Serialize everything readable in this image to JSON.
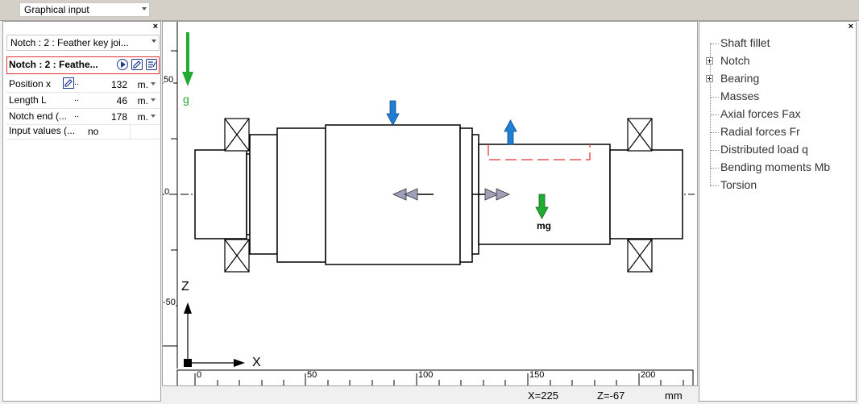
{
  "toolbar": {
    "view_select": "Graphical input"
  },
  "left_panel": {
    "close": "×",
    "element_select": "Notch : 2 : Feather key joi...",
    "header_title": "Notch : 2 : Feathe...",
    "rows": [
      {
        "label": "Position x",
        "value": "132",
        "unit": "m."
      },
      {
        "label": "Length L",
        "dots": "..",
        "value": "46",
        "unit": "m."
      },
      {
        "label": "Notch end (...",
        "dots": "..",
        "value": "178",
        "unit": "m."
      },
      {
        "label": "Input values (...",
        "value": "no"
      }
    ],
    "position_dots": ".."
  },
  "canvas": {
    "gravity_label": "g",
    "mass_label": "mg",
    "z_axis": "Z",
    "x_axis": "X",
    "vertical_ticks": [
      "50",
      "0",
      "-50"
    ],
    "horizontal_ticks": [
      "0",
      "50",
      "100",
      "150",
      "200"
    ],
    "colors": {
      "gravity": "#22aa33",
      "force": "#1e7fd4",
      "notch": "#e03030"
    }
  },
  "status": {
    "x": "X=225",
    "z": "Z=-67",
    "unit": "mm"
  },
  "right_panel": {
    "close": "×",
    "items": [
      {
        "label": "Shaft fillet",
        "expandable": false
      },
      {
        "label": "Notch",
        "expandable": true
      },
      {
        "label": "Bearing",
        "expandable": true
      },
      {
        "label": "Masses",
        "expandable": false
      },
      {
        "label": "Axial forces Fax",
        "expandable": false
      },
      {
        "label": "Radial forces Fr",
        "expandable": false
      },
      {
        "label": "Distributed load q",
        "expandable": false
      },
      {
        "label": "Bending moments Mb",
        "expandable": false
      },
      {
        "label": "Torsion",
        "expandable": false
      }
    ]
  }
}
